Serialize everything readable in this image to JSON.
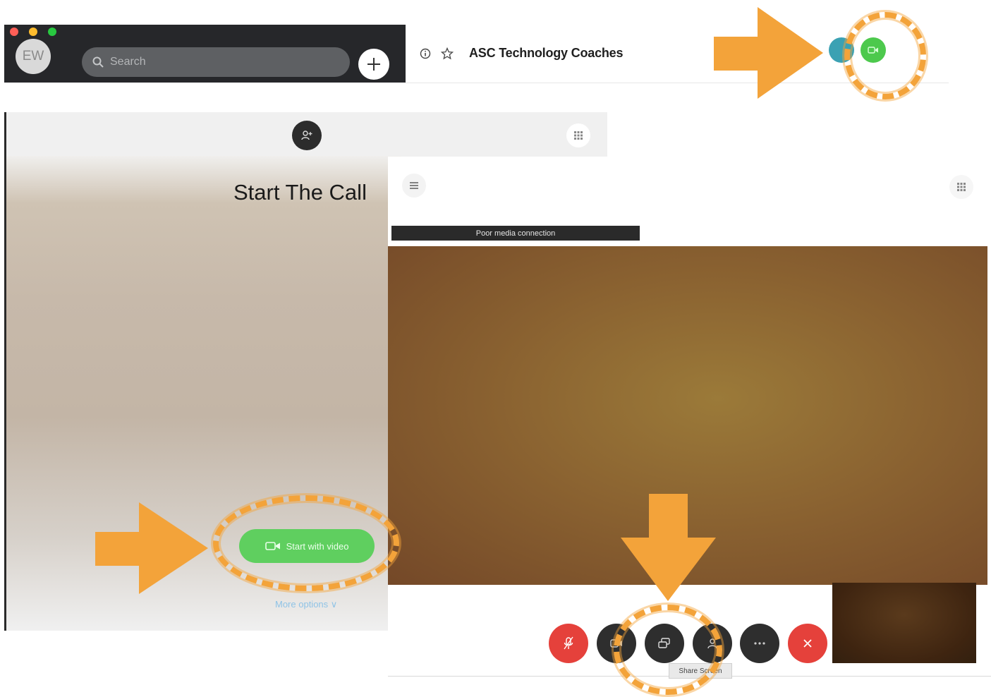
{
  "topbar": {
    "avatar_initials": "EW",
    "search_placeholder": "Search",
    "traffic_lights": [
      "#ff5f57",
      "#febc2e",
      "#28c840"
    ]
  },
  "space_header": {
    "title": "ASC Technology Coaches"
  },
  "start_call": {
    "title": "Start The Call",
    "start_with_video_label": "Start with video",
    "more_options_label": "More options ∨"
  },
  "call_window": {
    "status_banner": "Poor media connection",
    "tooltip": "Share Screen",
    "controls": [
      "mute-icon",
      "video-icon",
      "share-screen-icon",
      "more-icon",
      "more-options-icon",
      "end-call-icon"
    ],
    "colors": {
      "mute": "#e5413b",
      "neutral": "#2e2e2e",
      "end_call": "#e5413b",
      "accent_green": "#4dc94d",
      "annotation": "#f3a33a"
    }
  }
}
